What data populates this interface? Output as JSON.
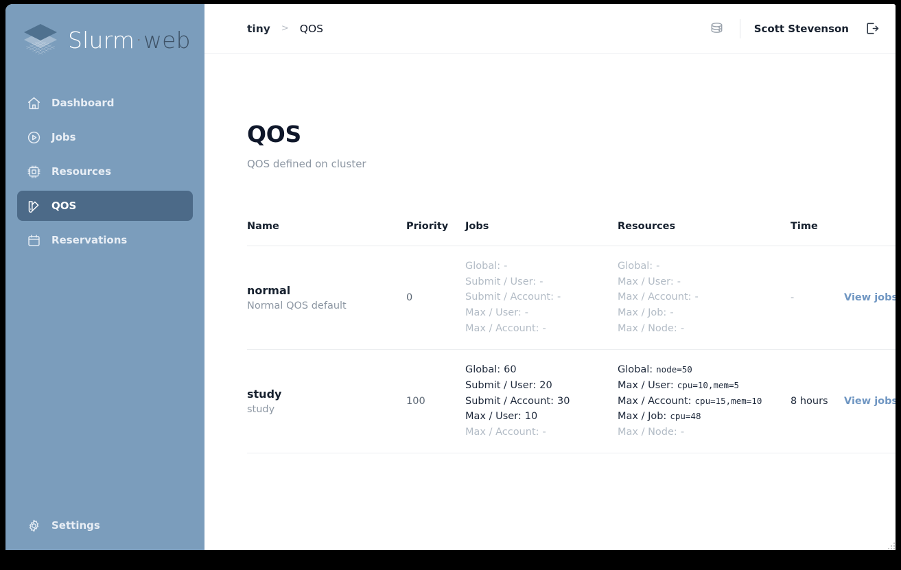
{
  "brand": {
    "word1": "Slurm",
    "separator": "·",
    "word2": "web",
    "logo_icon": "stacked-layers-icon"
  },
  "sidebar": {
    "items": [
      {
        "label": "Dashboard",
        "icon": "home-icon",
        "active": false
      },
      {
        "label": "Jobs",
        "icon": "play-circle-icon",
        "active": false
      },
      {
        "label": "Resources",
        "icon": "cpu-chip-icon",
        "active": false
      },
      {
        "label": "QOS",
        "icon": "swatch-icon",
        "active": true
      },
      {
        "label": "Reservations",
        "icon": "calendar-icon",
        "active": false
      }
    ],
    "bottom": {
      "label": "Settings",
      "icon": "gear-icon"
    }
  },
  "topbar": {
    "breadcrumb": {
      "root": "tiny",
      "separator": ">",
      "current": "QOS"
    },
    "cluster_icon": "server-stack-icon",
    "user": "Scott Stevenson",
    "logout_icon": "logout-icon"
  },
  "page": {
    "title": "QOS",
    "subtitle": "QOS defined on cluster"
  },
  "table": {
    "columns": [
      "Name",
      "Priority",
      "Jobs",
      "Resources",
      "Time"
    ],
    "action_label": "View jobs",
    "rows": [
      {
        "name": "normal",
        "description": "Normal QOS default",
        "priority": "0",
        "jobs": [
          {
            "key": "Global:",
            "value": "-",
            "set": false
          },
          {
            "key": "Submit / User:",
            "value": "-",
            "set": false
          },
          {
            "key": "Submit / Account:",
            "value": "-",
            "set": false
          },
          {
            "key": "Max / User:",
            "value": "-",
            "set": false
          },
          {
            "key": "Max / Account:",
            "value": "-",
            "set": false
          }
        ],
        "resources": [
          {
            "key": "Global:",
            "value": "-",
            "set": false,
            "mono": false
          },
          {
            "key": "Max / User:",
            "value": "-",
            "set": false,
            "mono": false
          },
          {
            "key": "Max / Account:",
            "value": "-",
            "set": false,
            "mono": false
          },
          {
            "key": "Max / Job:",
            "value": "-",
            "set": false,
            "mono": false
          },
          {
            "key": "Max / Node:",
            "value": "-",
            "set": false,
            "mono": false
          }
        ],
        "time": "-",
        "time_set": false
      },
      {
        "name": "study",
        "description": "study",
        "priority": "100",
        "jobs": [
          {
            "key": "Global:",
            "value": "60",
            "set": true
          },
          {
            "key": "Submit / User:",
            "value": "20",
            "set": true
          },
          {
            "key": "Submit / Account:",
            "value": "30",
            "set": true
          },
          {
            "key": "Max / User:",
            "value": "10",
            "set": true
          },
          {
            "key": "Max / Account:",
            "value": "-",
            "set": false
          }
        ],
        "resources": [
          {
            "key": "Global:",
            "value": "node=50",
            "set": true,
            "mono": true
          },
          {
            "key": "Max / User:",
            "value": "cpu=10,mem=5",
            "set": true,
            "mono": true
          },
          {
            "key": "Max / Account:",
            "value": "cpu=15,mem=10",
            "set": true,
            "mono": true
          },
          {
            "key": "Max / Job:",
            "value": "cpu=48",
            "set": true,
            "mono": true
          },
          {
            "key": "Max / Node:",
            "value": "-",
            "set": false,
            "mono": false
          }
        ],
        "time": "8 hours",
        "time_set": true
      }
    ]
  },
  "colors": {
    "sidebar_bg": "#7b9dbc",
    "sidebar_active_bg": "#4c6a88",
    "link": "#6f96c2",
    "title": "#0f172a",
    "muted": "#8d97a3",
    "unset": "#b3bcc6"
  }
}
